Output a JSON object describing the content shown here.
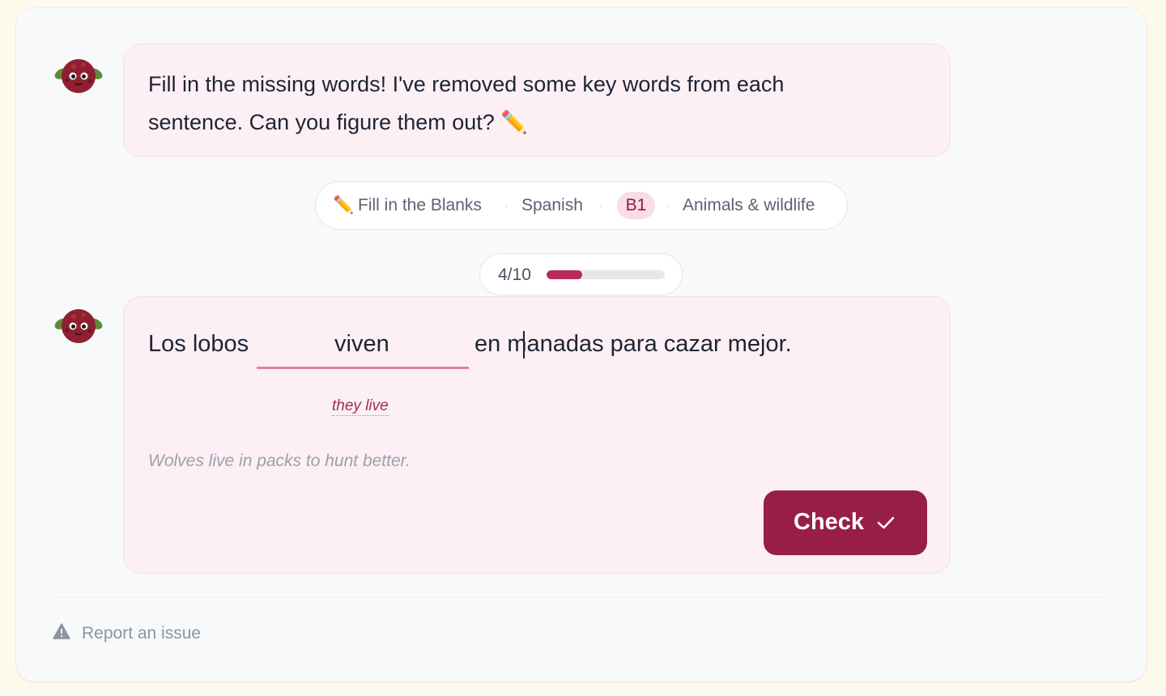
{
  "prompt": {
    "line1": "Fill in the missing words! I've removed some key words from each",
    "line2": "sentence. Can you figure them out? ✏️"
  },
  "chips": {
    "mode_icon": "✏️",
    "mode": "Fill in the Blanks",
    "language": "Spanish",
    "level": "B1",
    "topic": "Animals & wildlife",
    "separator": "·"
  },
  "progress": {
    "label": "4/10",
    "fraction": 0.3
  },
  "exercise": {
    "before": "Los lobos",
    "answer": "viven",
    "after": "en manadas para cazar mejor.",
    "hint": "they live",
    "translation": "Wolves live in packs to hunt better."
  },
  "check_button": {
    "label": "Check",
    "icon": "checkmark-icon"
  },
  "footer": {
    "report_label": "Report an issue",
    "icon": "warning-icon"
  },
  "colors": {
    "accent": "#971f47",
    "progress_fill": "#b82a5c",
    "bubble_bg": "#fcf0f5",
    "page_bg": "#fdfaec"
  }
}
